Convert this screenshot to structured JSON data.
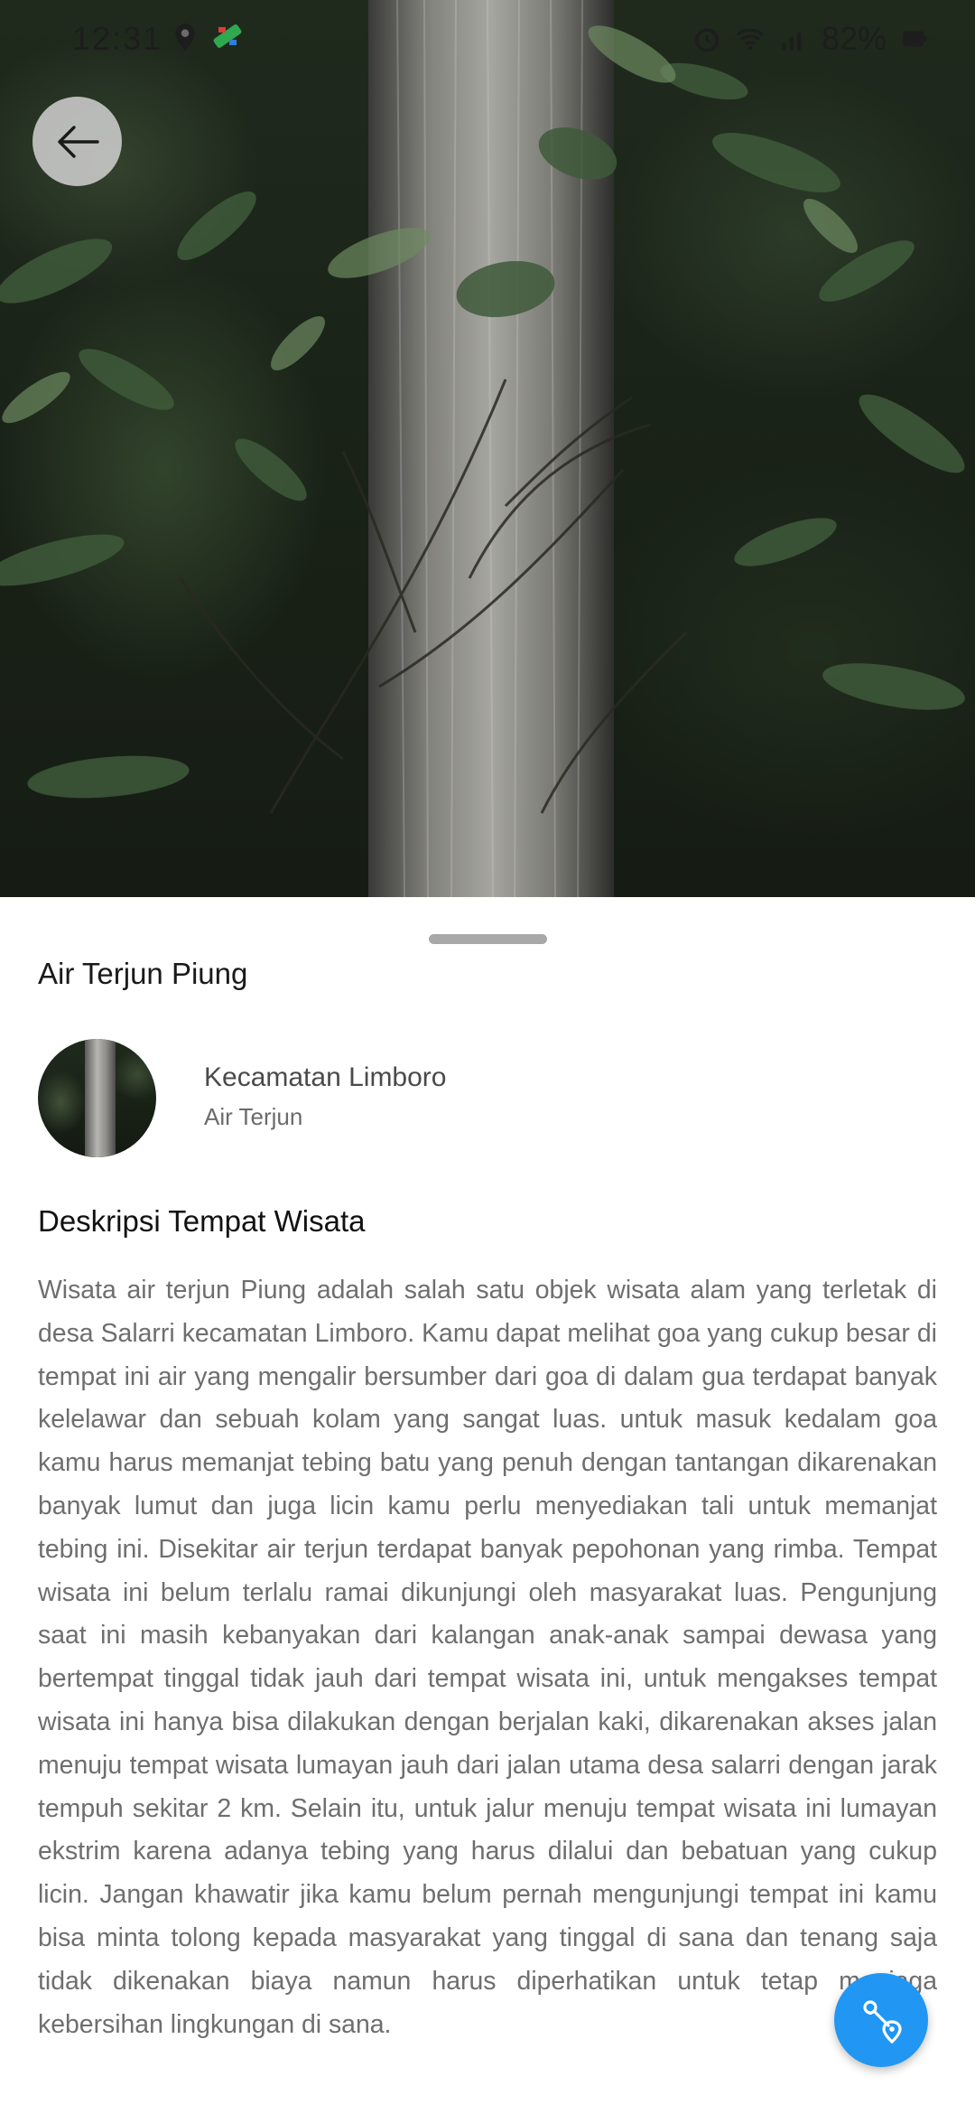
{
  "status_bar": {
    "time": "12:31",
    "battery": "82%",
    "icons": [
      "location-icon",
      "app-notification-icon",
      "alarm-icon",
      "wifi-icon",
      "signal-icon",
      "battery-icon"
    ]
  },
  "header": {
    "back_icon": "arrow-left-icon"
  },
  "place": {
    "title": "Air Terjun Piung",
    "district": "Kecamatan Limboro",
    "category": "Air Terjun"
  },
  "description": {
    "heading": "Deskripsi Tempat Wisata",
    "body": "Wisata air terjun Piung adalah salah satu objek wisata alam yang terletak di desa Salarri kecamatan Limboro. Kamu dapat melihat goa yang cukup besar di tempat ini air yang mengalir bersumber dari goa di dalam gua terdapat banyak kelelawar dan sebuah kolam yang sangat luas. untuk masuk kedalam goa kamu harus memanjat tebing batu yang penuh dengan tantangan dikarenakan banyak lumut dan juga licin kamu perlu menyediakan tali untuk memanjat tebing ini. Disekitar air terjun terdapat banyak pepohonan yang rimba. Tempat wisata ini belum terlalu ramai dikunjungi oleh masyarakat luas. Pengunjung saat ini masih kebanyakan dari kalangan anak-anak sampai dewasa yang bertempat tinggal tidak jauh dari tempat wisata ini, untuk mengakses tempat wisata ini hanya bisa dilakukan dengan berjalan kaki, dikarenakan akses jalan menuju tempat wisata lumayan jauh dari jalan utama desa salarri dengan jarak tempuh sekitar 2 km. Selain itu, untuk jalur menuju tempat wisata ini lumayan ekstrim karena adanya tebing yang harus dilalui dan bebatuan yang cukup licin. Jangan khawatir jika kamu belum pernah mengunjungi tempat ini kamu bisa minta tolong kepada masyarakat yang tinggal di sana dan tenang saja tidak dikenakan biaya namun harus diperhatikan untuk tetap menjaga kebersihan lingkungan di sana."
  },
  "fab": {
    "icon": "route-icon",
    "color": "#2196f3"
  }
}
